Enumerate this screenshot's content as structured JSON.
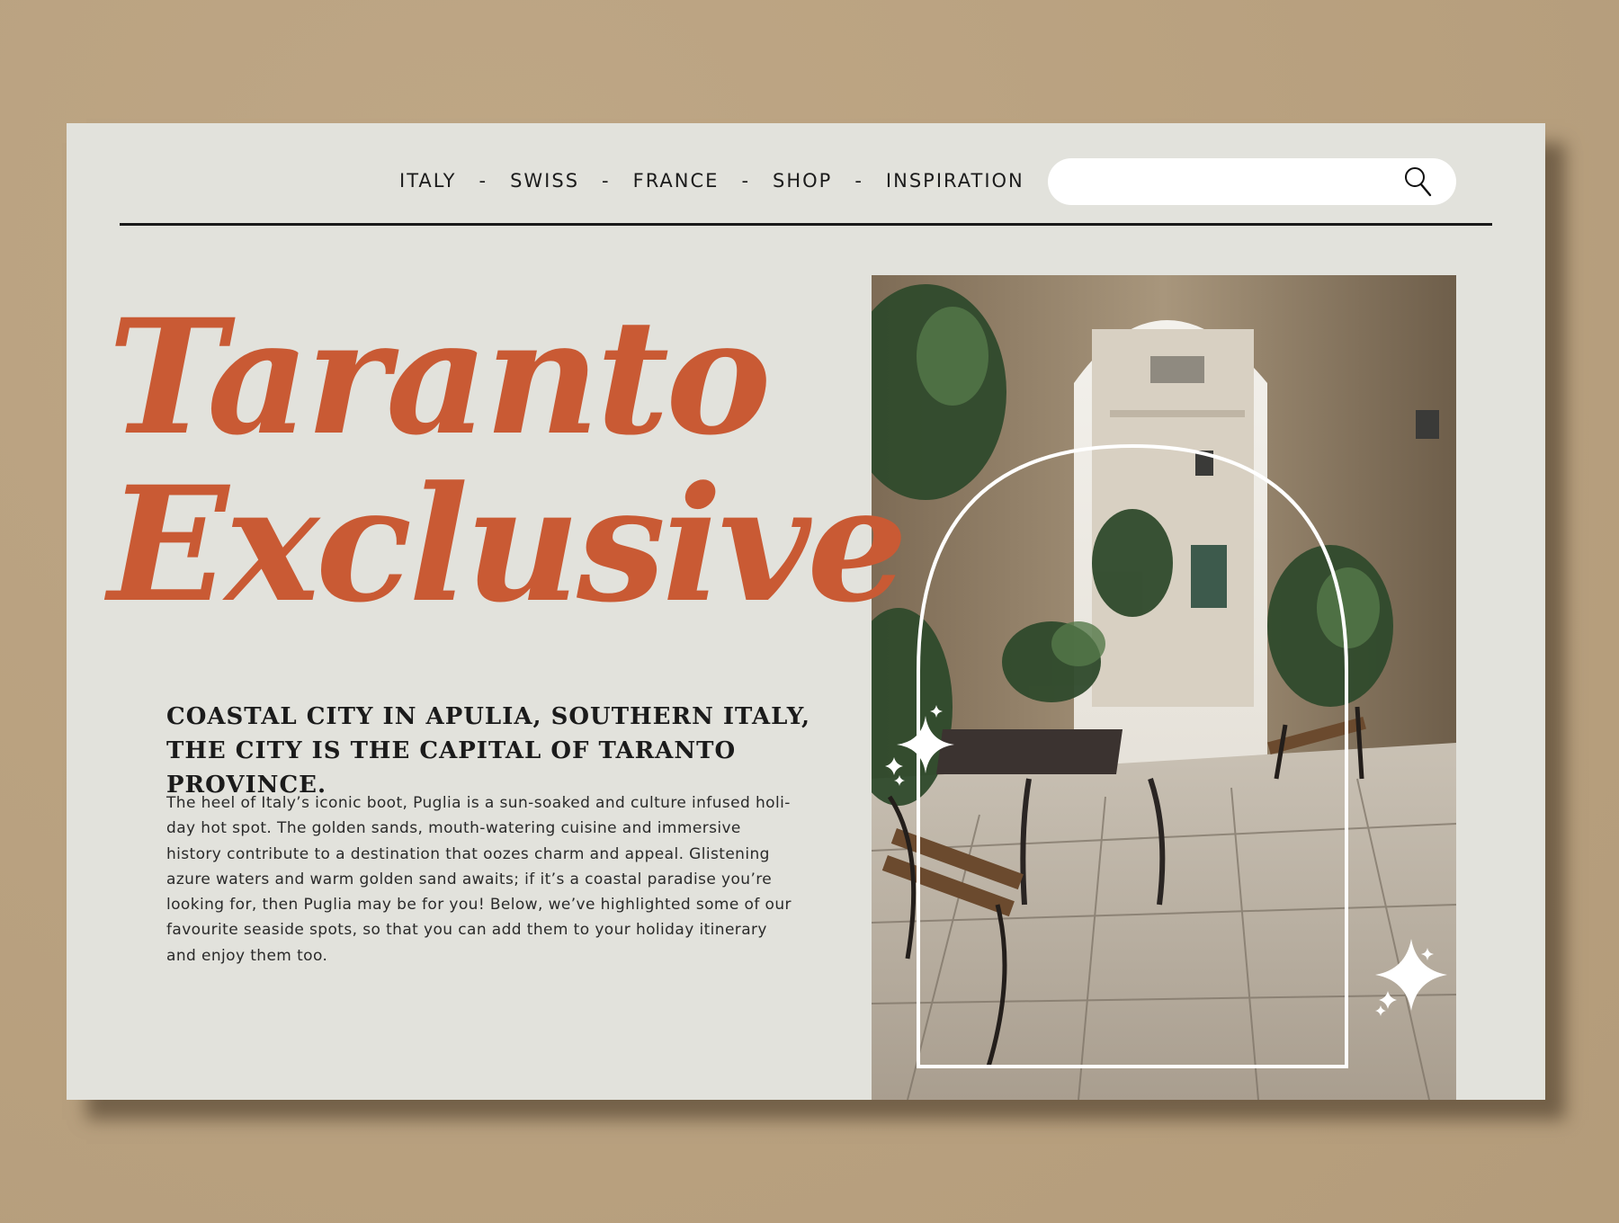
{
  "nav": {
    "items": [
      "ITALY",
      "SWISS",
      "FRANCE",
      "SHOP",
      "INSPIRATION"
    ],
    "separator": "-"
  },
  "search": {
    "placeholder": "",
    "icon": "search-icon"
  },
  "hero": {
    "title_line1": "Taranto",
    "title_line2": "Exclusive",
    "subheading": "COASTAL CITY IN APULIA, SOUTHERN ITALY, THE CITY IS THE CAPITAL OF TARANTO PROVINCE.",
    "paragraph": "The heel of Italy’s iconic boot, Puglia is a sun-soaked and culture infused holi-day hot spot. The golden sands, mouth-watering cuisine and immersive history contribute to a destination that oozes charm and appeal. Glistening azure waters and warm golden sand awaits; if it’s a coastal paradise you’re looking for, then Puglia may be for you! Below, we’ve highlighted some of our favourite seaside spots, so that you can add them to your holiday itinerary and enjoy them too."
  },
  "image": {
    "icons": [
      "sparkle-icon",
      "arch-frame"
    ]
  },
  "colors": {
    "background": "#bba27f",
    "card": "#e2e2dc",
    "accent": "#c95a34",
    "text": "#1b1b1b"
  }
}
